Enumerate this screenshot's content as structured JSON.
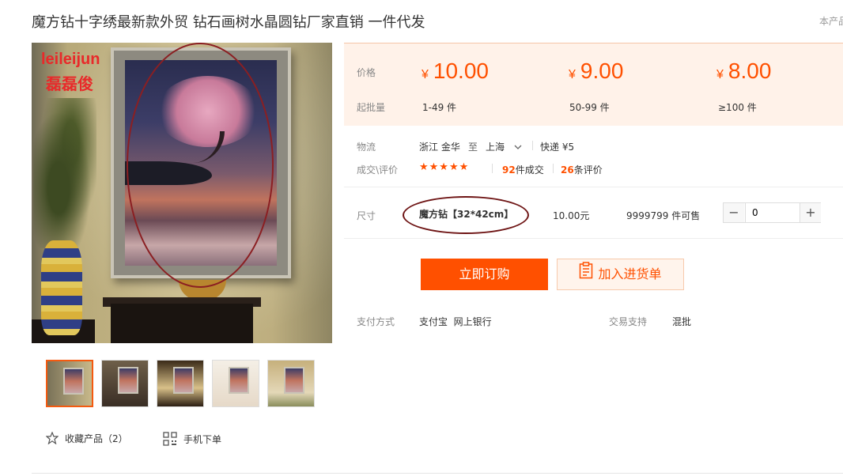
{
  "title": "魔方钻十字绣最新款外贸 钻石画树水晶圆钻厂家直销 一件代发",
  "top_right": "本产品",
  "image": {
    "watermark_en": "leileijun",
    "watermark_cn": "磊磊俊",
    "thumbnails": 5
  },
  "price_panel": {
    "price_label": "价格",
    "qty_label": "起批量",
    "currency": "¥",
    "tiers": [
      {
        "price": "10.00",
        "qty": "1-49 件"
      },
      {
        "price": "9.00",
        "qty": "50-99 件"
      },
      {
        "price": "8.00",
        "qty": "≥100 件"
      }
    ]
  },
  "logistics": {
    "label": "物流",
    "from": "浙江 金华",
    "to_word": "至",
    "to": "上海",
    "express": "快递 ¥5"
  },
  "deals": {
    "label": "成交\\评价",
    "stars": "★★★★★",
    "rating": 5,
    "deals_count": "92",
    "deals_suffix": "件成交",
    "reviews_count": "26",
    "reviews_suffix": "条评价"
  },
  "sku": {
    "label": "尺寸",
    "name": "魔方钻【32*42cm】",
    "price": "10.00元",
    "stock": "9999799 件可售",
    "quantity": "0",
    "minus": "−",
    "plus": "+"
  },
  "actions": {
    "buy": "立即订购",
    "cart": "加入进货单"
  },
  "payment": {
    "label": "支付方式",
    "methods": "支付宝  网上银行",
    "trade_label": "交易支持",
    "trade_value": "混批"
  },
  "footer": {
    "favorite": "收藏产品（2）",
    "mobile": "手机下单"
  },
  "colors": {
    "accent": "#ff5000",
    "price_bg": "#fff2e9",
    "annotation": "#8b1f22"
  }
}
